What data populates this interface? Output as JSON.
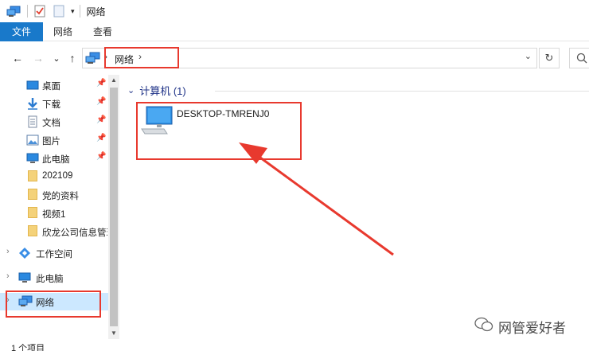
{
  "window": {
    "title": "网络"
  },
  "ribbon": {
    "tabs": [
      "文件",
      "网络",
      "查看"
    ]
  },
  "nav": {
    "back": "←",
    "forward": "→",
    "recent": "⌄",
    "up": "↑"
  },
  "address": {
    "crumb": "网络",
    "separator": "›",
    "dropdown": "⌄",
    "refresh": "↻"
  },
  "sidebar": {
    "quick_access": [
      {
        "label": "桌面",
        "icon": "desktop-icon",
        "pinned": true
      },
      {
        "label": "下载",
        "icon": "download-icon",
        "pinned": true
      },
      {
        "label": "文档",
        "icon": "document-icon",
        "pinned": true
      },
      {
        "label": "图片",
        "icon": "picture-icon",
        "pinned": true
      },
      {
        "label": "此电脑",
        "icon": "computer-icon",
        "pinned": true
      },
      {
        "label": "202109",
        "icon": "folder-icon",
        "pinned": false
      },
      {
        "label": "党的资料",
        "icon": "folder-icon",
        "pinned": false
      },
      {
        "label": "视频1",
        "icon": "folder-icon",
        "pinned": false
      },
      {
        "label": "欣龙公司信息管理",
        "icon": "folder-icon",
        "pinned": false
      }
    ],
    "workspace": "工作空间",
    "this_pc": "此电脑",
    "network": "网络"
  },
  "content": {
    "group_header": "计算机 (1)",
    "items": [
      {
        "name": "DESKTOP-TMRENJ0",
        "icon": "computer-icon"
      }
    ]
  },
  "status": {
    "item_count": "1 个项目"
  },
  "watermark": {
    "text": "网管爱好者"
  },
  "colors": {
    "accent": "#1979ca",
    "annotation": "#e8392e",
    "selection": "#cce8ff",
    "group_header": "#1e3287"
  }
}
